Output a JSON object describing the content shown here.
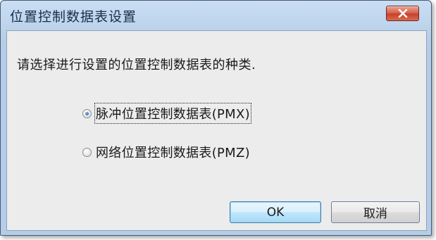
{
  "window": {
    "title": "位置控制数据表设置",
    "close_icon": "close-x-icon"
  },
  "dialog": {
    "prompt": "请选择进行设置的位置控制数据表的种类.",
    "options": [
      {
        "label": "脉冲位置控制数据表(PMX)",
        "selected": true
      },
      {
        "label": "网络位置控制数据表(PMZ)",
        "selected": false
      }
    ],
    "ok_label": "OK",
    "cancel_label": "取消"
  },
  "colors": {
    "title_bar": "#bcd3ec",
    "close_button": "#c8412b",
    "client_background": "#ececec",
    "default_button": "#bee6fd"
  }
}
